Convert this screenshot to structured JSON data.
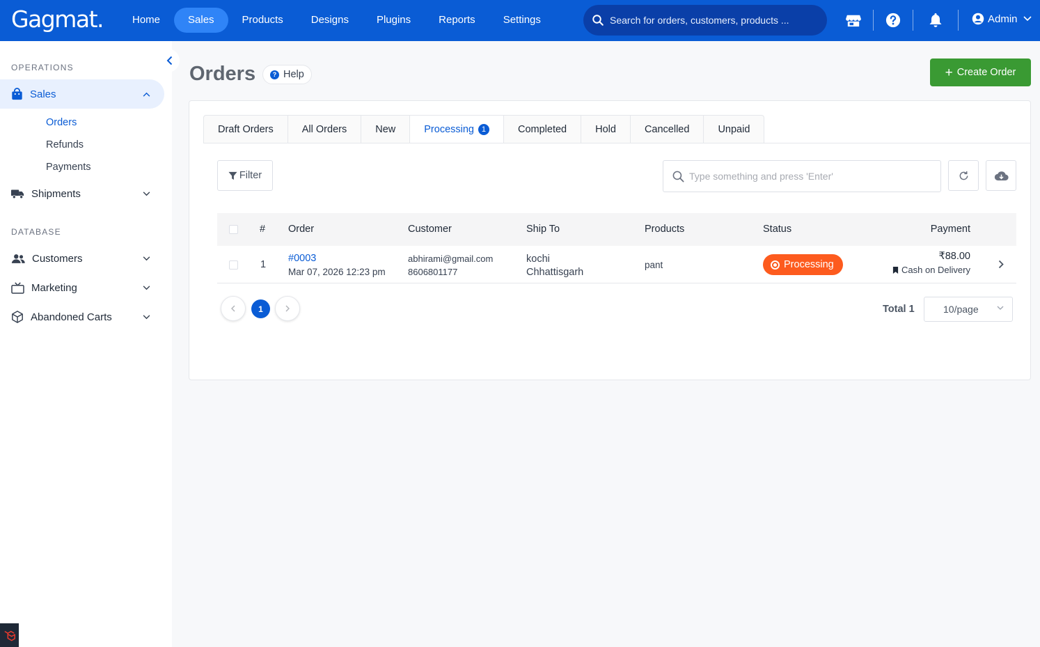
{
  "app": {
    "logo": "Gagmat."
  },
  "topnav": {
    "items": [
      {
        "label": "Home"
      },
      {
        "label": "Sales",
        "active": true
      },
      {
        "label": "Products"
      },
      {
        "label": "Designs"
      },
      {
        "label": "Plugins"
      },
      {
        "label": "Reports"
      },
      {
        "label": "Settings"
      }
    ],
    "search_placeholder": "Search for orders, customers, products ...",
    "user": "Admin"
  },
  "sidebar": {
    "section_operations": "OPERATIONS",
    "sales": "Sales",
    "sales_sub": [
      "Orders",
      "Refunds",
      "Payments"
    ],
    "shipments": "Shipments",
    "section_database": "DATABASE",
    "customers": "Customers",
    "marketing": "Marketing",
    "abandoned": "Abandoned Carts"
  },
  "page": {
    "title": "Orders",
    "help": "Help",
    "create": "Create Order"
  },
  "tabs": [
    {
      "label": "Draft Orders"
    },
    {
      "label": "All Orders"
    },
    {
      "label": "New"
    },
    {
      "label": "Processing",
      "badge": "1",
      "active": true
    },
    {
      "label": "Completed"
    },
    {
      "label": "Hold"
    },
    {
      "label": "Cancelled"
    },
    {
      "label": "Unpaid"
    }
  ],
  "toolbar": {
    "filter": "Filter",
    "search_placeholder": "Type something and press 'Enter'"
  },
  "table": {
    "headers": {
      "num": "#",
      "order": "Order",
      "customer": "Customer",
      "ship_to": "Ship To",
      "products": "Products",
      "status": "Status",
      "payment": "Payment"
    },
    "rows": [
      {
        "num": "1",
        "order_id": "#0003",
        "order_date": "Mar 07, 2026 12:23 pm",
        "customer_email": "abhirami@gmail.com",
        "customer_phone": "8606801177",
        "ship_city": "kochi",
        "ship_state": "Chhattisgarh",
        "products": "pant",
        "status": "Processing",
        "amount": "₹88.00",
        "method": "Cash on Delivery"
      }
    ]
  },
  "pagination": {
    "current": "1",
    "total": "Total 1",
    "page_size": "10/page"
  },
  "colors": {
    "primary": "#0a5cd5",
    "success": "#3a9a33",
    "processing": "#fd5b1e"
  }
}
